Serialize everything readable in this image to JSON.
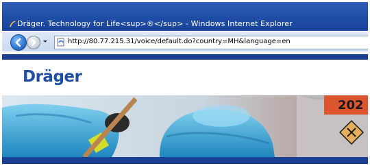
{
  "window": {
    "title": "Dräger. Technology for Life<sup>®</sup> - Windows Internet Explorer"
  },
  "navbar": {
    "address": "http://80.77.215.31/voice/default.do?country=MH&language=en"
  },
  "site": {
    "logo_text": "Dräger",
    "hero_sign_text": "202"
  },
  "colors": {
    "titlebar": "#1f4da6",
    "brand_blue": "#1f4ea3",
    "suit_cyan": "#3aa8d8"
  }
}
